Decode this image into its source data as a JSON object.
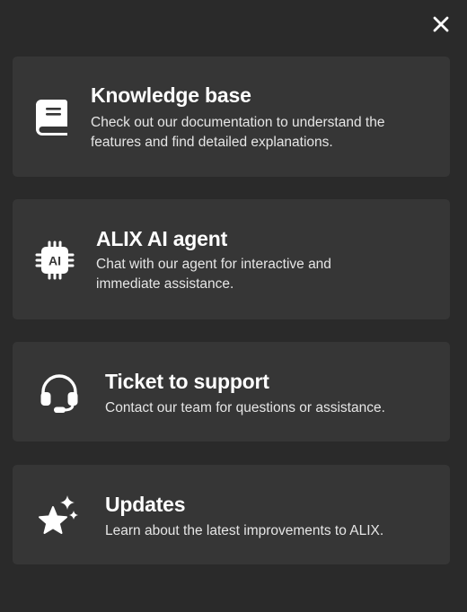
{
  "panel": {
    "close_icon": "close-icon"
  },
  "cards": [
    {
      "icon": "book-icon",
      "title": "Knowledge base",
      "description_line1": "Check out our documentation to understand the",
      "description_line2": "features and find detailed explanations."
    },
    {
      "icon": "ai-chip-icon",
      "icon_text": "AI",
      "title": "ALIX AI agent",
      "description_line1": "Chat with our agent for interactive and",
      "description_line2": "immediate assistance."
    },
    {
      "icon": "headset-icon",
      "title": "Ticket to support",
      "description_line1": "Contact our team for questions or assistance."
    },
    {
      "icon": "sparkles-star-icon",
      "title": "Updates",
      "description_line1": "Learn about the latest improvements to ALIX."
    }
  ]
}
